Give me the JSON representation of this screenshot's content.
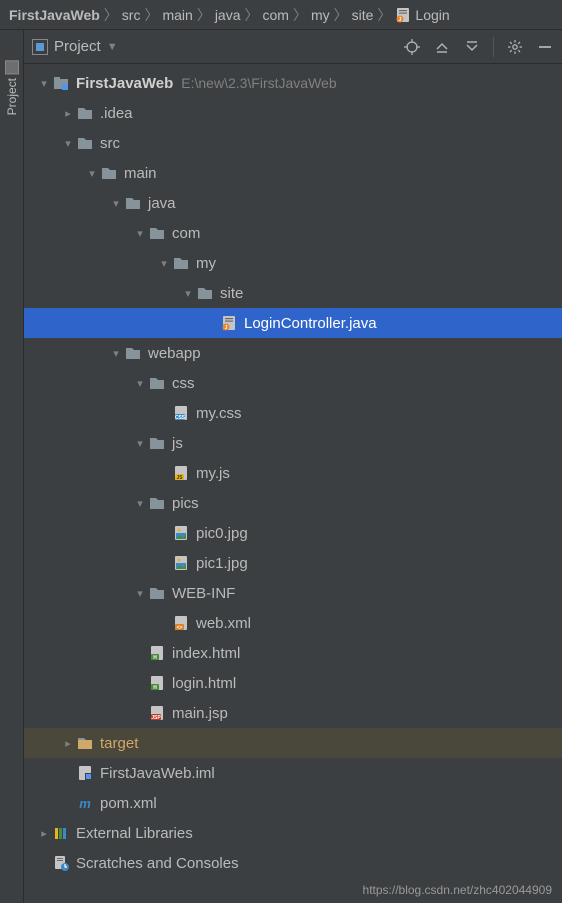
{
  "breadcrumb": [
    {
      "label": "FirstJavaWeb",
      "bold": true,
      "icon": null
    },
    {
      "label": "src",
      "bold": false,
      "icon": null
    },
    {
      "label": "main",
      "bold": false,
      "icon": null
    },
    {
      "label": "java",
      "bold": false,
      "icon": null
    },
    {
      "label": "com",
      "bold": false,
      "icon": null
    },
    {
      "label": "my",
      "bold": false,
      "icon": null
    },
    {
      "label": "site",
      "bold": false,
      "icon": null
    },
    {
      "label": "Login",
      "bold": false,
      "icon": "java"
    }
  ],
  "panel": {
    "title": "Project"
  },
  "sidebar": {
    "tab_label": "Project"
  },
  "tree": [
    {
      "depth": 0,
      "arrow": "down",
      "icon": "module",
      "label": "FirstJavaWeb",
      "bold": true,
      "path": "E:\\new\\2.3\\FirstJavaWeb",
      "state": ""
    },
    {
      "depth": 1,
      "arrow": "right",
      "icon": "folder",
      "label": ".idea",
      "bold": false,
      "path": "",
      "state": ""
    },
    {
      "depth": 1,
      "arrow": "down",
      "icon": "folder",
      "label": "src",
      "bold": false,
      "path": "",
      "state": ""
    },
    {
      "depth": 2,
      "arrow": "down",
      "icon": "folder",
      "label": "main",
      "bold": false,
      "path": "",
      "state": ""
    },
    {
      "depth": 3,
      "arrow": "down",
      "icon": "folder",
      "label": "java",
      "bold": false,
      "path": "",
      "state": ""
    },
    {
      "depth": 4,
      "arrow": "down",
      "icon": "folder",
      "label": "com",
      "bold": false,
      "path": "",
      "state": ""
    },
    {
      "depth": 5,
      "arrow": "down",
      "icon": "folder",
      "label": "my",
      "bold": false,
      "path": "",
      "state": ""
    },
    {
      "depth": 6,
      "arrow": "down",
      "icon": "folder",
      "label": "site",
      "bold": false,
      "path": "",
      "state": ""
    },
    {
      "depth": 7,
      "arrow": "none",
      "icon": "java",
      "label": "LoginController.java",
      "bold": false,
      "path": "",
      "state": "selected"
    },
    {
      "depth": 3,
      "arrow": "down",
      "icon": "folder",
      "label": "webapp",
      "bold": false,
      "path": "",
      "state": ""
    },
    {
      "depth": 4,
      "arrow": "down",
      "icon": "folder",
      "label": "css",
      "bold": false,
      "path": "",
      "state": ""
    },
    {
      "depth": 5,
      "arrow": "none",
      "icon": "css",
      "label": "my.css",
      "bold": false,
      "path": "",
      "state": ""
    },
    {
      "depth": 4,
      "arrow": "down",
      "icon": "folder",
      "label": "js",
      "bold": false,
      "path": "",
      "state": ""
    },
    {
      "depth": 5,
      "arrow": "none",
      "icon": "js",
      "label": "my.js",
      "bold": false,
      "path": "",
      "state": ""
    },
    {
      "depth": 4,
      "arrow": "down",
      "icon": "folder",
      "label": "pics",
      "bold": false,
      "path": "",
      "state": ""
    },
    {
      "depth": 5,
      "arrow": "none",
      "icon": "image",
      "label": "pic0.jpg",
      "bold": false,
      "path": "",
      "state": ""
    },
    {
      "depth": 5,
      "arrow": "none",
      "icon": "image",
      "label": "pic1.jpg",
      "bold": false,
      "path": "",
      "state": ""
    },
    {
      "depth": 4,
      "arrow": "down",
      "icon": "folder",
      "label": "WEB-INF",
      "bold": false,
      "path": "",
      "state": ""
    },
    {
      "depth": 5,
      "arrow": "none",
      "icon": "xml",
      "label": "web.xml",
      "bold": false,
      "path": "",
      "state": ""
    },
    {
      "depth": 4,
      "arrow": "none",
      "icon": "html",
      "label": "index.html",
      "bold": false,
      "path": "",
      "state": ""
    },
    {
      "depth": 4,
      "arrow": "none",
      "icon": "html",
      "label": "login.html",
      "bold": false,
      "path": "",
      "state": ""
    },
    {
      "depth": 4,
      "arrow": "none",
      "icon": "jsp",
      "label": "main.jsp",
      "bold": false,
      "path": "",
      "state": ""
    },
    {
      "depth": 1,
      "arrow": "right",
      "icon": "folder",
      "label": "target",
      "bold": false,
      "path": "",
      "state": "target"
    },
    {
      "depth": 1,
      "arrow": "none",
      "icon": "iml",
      "label": "FirstJavaWeb.iml",
      "bold": false,
      "path": "",
      "state": ""
    },
    {
      "depth": 1,
      "arrow": "none",
      "icon": "maven",
      "label": "pom.xml",
      "bold": false,
      "path": "",
      "state": ""
    },
    {
      "depth": 0,
      "arrow": "right",
      "icon": "lib",
      "label": "External Libraries",
      "bold": false,
      "path": "",
      "state": ""
    },
    {
      "depth": 0,
      "arrow": "none",
      "icon": "scratch",
      "label": "Scratches and Consoles",
      "bold": false,
      "path": "",
      "state": ""
    }
  ],
  "watermark": "https://blog.csdn.net/zhc402044909"
}
